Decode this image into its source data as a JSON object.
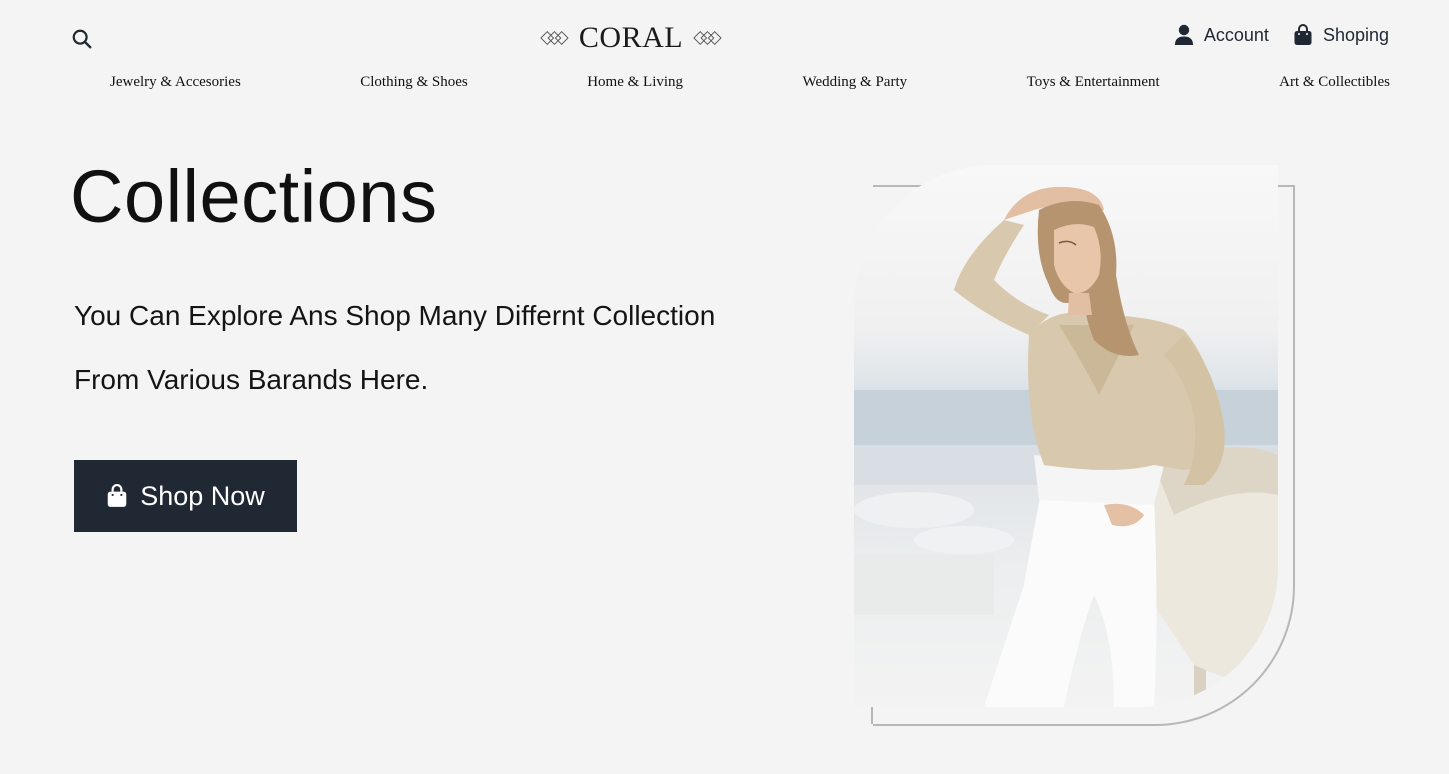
{
  "header": {
    "logo_text": "CORAL",
    "account_label": "Account",
    "shopping_label": "Shoping",
    "search_icon": "search-icon"
  },
  "nav": {
    "items": [
      "Jewelry & Accesories",
      "Clothing & Shoes",
      "Home & Living",
      "Wedding & Party",
      "Toys & Entertainment",
      "Art & Collectibles"
    ]
  },
  "hero": {
    "title": "Collections",
    "subtitle_line1": "You Can Explore Ans Shop Many Differnt Collection",
    "subtitle_line2": "From Various Barands Here.",
    "cta_label": "Shop Now",
    "image_alt": "woman in beige blouse and white jeans by the sea"
  },
  "colors": {
    "background": "#f4f4f4",
    "button_bg": "#1f2833",
    "button_text": "#ffffff",
    "outline": "#b7b7b7"
  }
}
